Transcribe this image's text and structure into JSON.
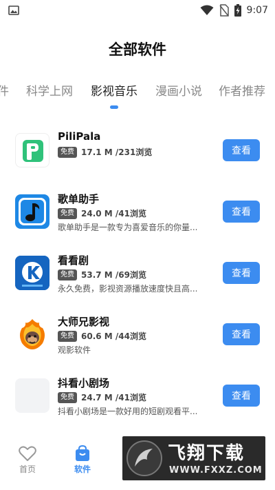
{
  "status_bar": {
    "time": "9:07"
  },
  "page": {
    "title": "全部软件"
  },
  "tabs": [
    {
      "label": "件"
    },
    {
      "label": "科学上网"
    },
    {
      "label": "影视音乐"
    },
    {
      "label": "漫画小说"
    },
    {
      "label": "作者推荐"
    }
  ],
  "active_tab": "影视音乐",
  "apps": [
    {
      "name": "PiliPala",
      "badge": "免费",
      "size": "17.1 M /231浏览",
      "desc": "",
      "button": "查看",
      "icon": "pilipala-icon"
    },
    {
      "name": "歌单助手",
      "badge": "免费",
      "size": "24.0 M /41浏览",
      "desc": "歌单助手是一款专为喜爱音乐的你量...",
      "button": "查看",
      "icon": "music-note-icon"
    },
    {
      "name": "看看剧",
      "badge": "免费",
      "size": "53.7 M /69浏览",
      "desc": "永久免费，影视资源播放速度快且高...",
      "button": "查看",
      "icon": "kankanju-icon"
    },
    {
      "name": "大师兄影视",
      "badge": "免费",
      "size": "60.6 M /44浏览",
      "desc": "观影软件",
      "button": "查看",
      "icon": "monkey-flame-icon"
    },
    {
      "name": "抖看小剧场",
      "badge": "免费",
      "size": "24.7 M /41浏览",
      "desc": "抖看小剧场是一款好用的短剧观看平...",
      "button": "查看",
      "icon": "placeholder-icon"
    }
  ],
  "bottom_nav": [
    {
      "label": "首页",
      "icon": "heart-icon"
    },
    {
      "label": "软件",
      "icon": "bag-icon",
      "active": true
    }
  ],
  "watermark": {
    "main": "飞翔下载",
    "url": "WWW.FXXZ.COM"
  },
  "colors": {
    "accent": "#3c8cf0",
    "badge": "#555555"
  }
}
